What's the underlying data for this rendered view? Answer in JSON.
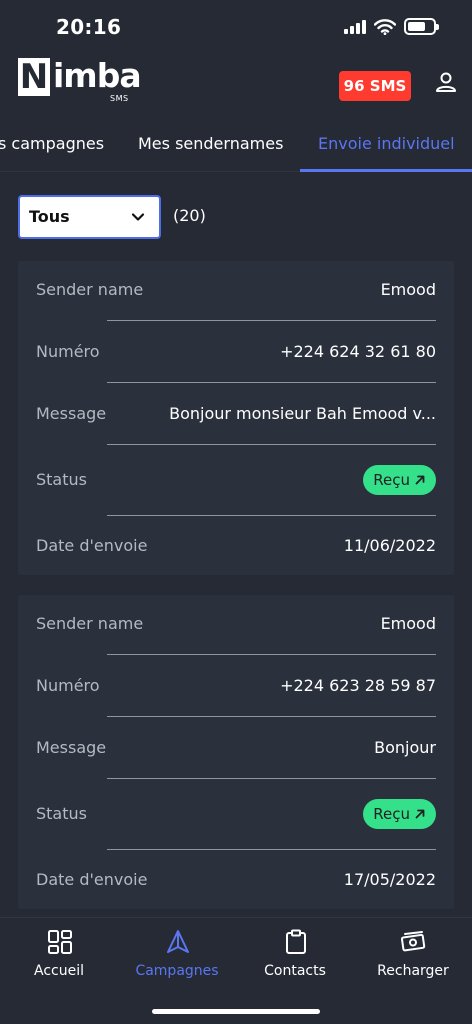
{
  "status_bar": {
    "time": "20:16"
  },
  "header": {
    "logo_letter": "N",
    "logo_rest": "imba",
    "logo_sub": "SMS",
    "sms_balance": "96 SMS"
  },
  "tabs": [
    {
      "label": "s campagnes",
      "active": false
    },
    {
      "label": "Mes sendernames",
      "active": false
    },
    {
      "label": "Envoie individuel",
      "active": true
    }
  ],
  "filter": {
    "selected": "Tous",
    "count": "(20)"
  },
  "labels": {
    "sender": "Sender name",
    "number": "Numéro",
    "message": "Message",
    "status": "Status",
    "date": "Date d'envoie"
  },
  "messages": [
    {
      "sender": "Emood",
      "number": "+224 624 32 61 80",
      "message": "Bonjour monsieur Bah Emood v...",
      "status": "Reçu",
      "date": "11/06/2022"
    },
    {
      "sender": "Emood",
      "number": "+224 623 28 59 87",
      "message": "Bonjour",
      "status": "Reçu",
      "date": "17/05/2022"
    }
  ],
  "colors": {
    "accent": "#5a76f0",
    "badge": "#ff3b30",
    "status_ok": "#34e08a",
    "background": "#252a35",
    "card": "#2a303c"
  },
  "bottom_nav": [
    {
      "label": "Accueil",
      "icon": "grid-icon",
      "active": false
    },
    {
      "label": "Campagnes",
      "icon": "send-icon",
      "active": true
    },
    {
      "label": "Contacts",
      "icon": "clipboard-icon",
      "active": false
    },
    {
      "label": "Recharger",
      "icon": "money-icon",
      "active": false
    }
  ]
}
